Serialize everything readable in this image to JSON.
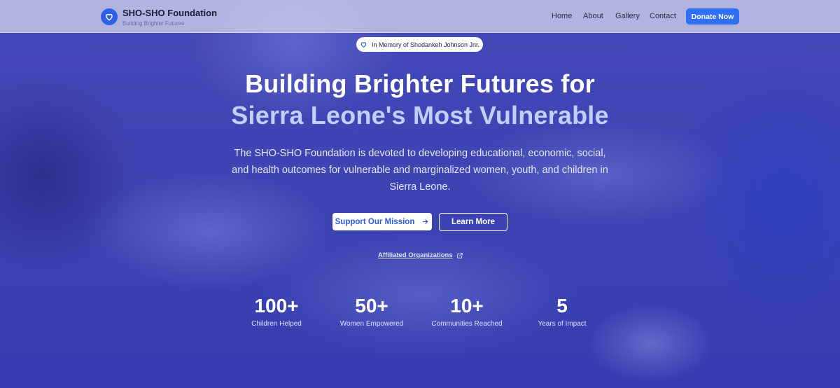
{
  "header": {
    "brand_name": "SHO-SHO Foundation",
    "brand_tagline": "Building Brighter Futures",
    "nav": [
      "Home",
      "About",
      "Gallery",
      "Contact"
    ],
    "donate_label": "Donate Now"
  },
  "hero": {
    "memory_badge": "In Memory of Shodankeh Johnson Jnr.",
    "headline_line1": "Building Brighter Futures for",
    "headline_line2": "Sierra Leone's Most Vulnerable",
    "description": "The SHO-SHO Foundation is devoted to developing educational, economic, social, and health outcomes for vulnerable and marginalized women, youth, and children in Sierra Leone.",
    "primary_cta": "Support Our Mission",
    "secondary_cta": "Learn More",
    "affiliated_link": "Affiliated Organizations"
  },
  "stats": [
    {
      "value": "100+",
      "label": "Children Helped"
    },
    {
      "value": "50+",
      "label": "Women Empowered"
    },
    {
      "value": "10+",
      "label": "Communities Reached"
    },
    {
      "value": "5",
      "label": "Years of Impact"
    }
  ],
  "colors": {
    "accent": "#2f6ff2",
    "overlay": "#3d43b2",
    "headline_highlight": "#bcd2fa"
  },
  "icons": {
    "logo": "heart-icon",
    "memory": "heart-icon",
    "cta_arrow": "arrow-right-icon",
    "external": "external-link-icon"
  }
}
